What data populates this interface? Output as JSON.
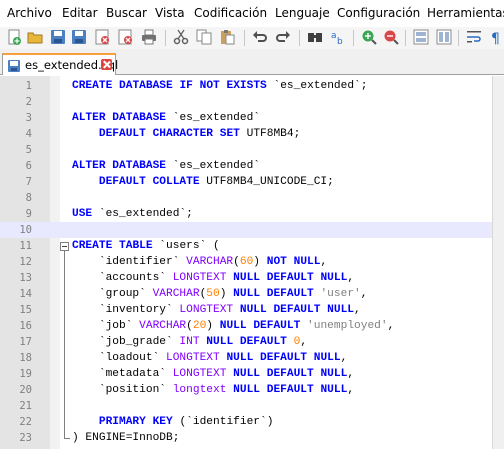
{
  "menu": [
    "Archivo",
    "Editar",
    "Buscar",
    "Vista",
    "Codificación",
    "Lenguaje",
    "Configuración",
    "Herramientas"
  ],
  "toolbar_icons": [
    "new-file-icon",
    "open-file-icon",
    "save-icon",
    "save-all-icon",
    "close-icon",
    "close-all-icon",
    "print-icon",
    "cut-icon",
    "copy-icon",
    "paste-icon",
    "undo-icon",
    "redo-icon",
    "find-icon",
    "replace-icon",
    "zoom-in-icon",
    "zoom-out-icon",
    "sync-v-icon",
    "sync-h-icon",
    "word-wrap-icon",
    "show-all-chars-icon"
  ],
  "tab": {
    "label": "es_extended.sql",
    "modified": true
  },
  "editor": {
    "current_line": 10,
    "lines": [
      {
        "n": "1",
        "code": "CREATE DATABASE IF NOT EXISTS `es_extended`;"
      },
      {
        "n": "2",
        "code": ""
      },
      {
        "n": "3",
        "code": "ALTER DATABASE `es_extended`"
      },
      {
        "n": "4",
        "code": "    DEFAULT CHARACTER SET UTF8MB4;"
      },
      {
        "n": "5",
        "code": ""
      },
      {
        "n": "6",
        "code": "ALTER DATABASE `es_extended`"
      },
      {
        "n": "7",
        "code": "    DEFAULT COLLATE UTF8MB4_UNICODE_CI;"
      },
      {
        "n": "8",
        "code": ""
      },
      {
        "n": "9",
        "code": "USE `es_extended`;"
      },
      {
        "n": "10",
        "code": ""
      },
      {
        "n": "11",
        "code": "CREATE TABLE `users` ("
      },
      {
        "n": "12",
        "code": "    `identifier` VARCHAR(60) NOT NULL,"
      },
      {
        "n": "13",
        "code": "    `accounts` LONGTEXT NULL DEFAULT NULL,"
      },
      {
        "n": "14",
        "code": "    `group` VARCHAR(50) NULL DEFAULT 'user',"
      },
      {
        "n": "15",
        "code": "    `inventory` LONGTEXT NULL DEFAULT NULL,"
      },
      {
        "n": "16",
        "code": "    `job` VARCHAR(20) NULL DEFAULT 'unemployed',"
      },
      {
        "n": "17",
        "code": "    `job_grade` INT NULL DEFAULT 0,"
      },
      {
        "n": "18",
        "code": "    `loadout` LONGTEXT NULL DEFAULT NULL,"
      },
      {
        "n": "19",
        "code": "    `metadata` LONGTEXT NULL DEFAULT NULL,"
      },
      {
        "n": "20",
        "code": "    `position` longtext NULL DEFAULT NULL,"
      },
      {
        "n": "21",
        "code": ""
      },
      {
        "n": "22",
        "code": "    PRIMARY KEY (`identifier`)"
      },
      {
        "n": "23",
        "code": ") ENGINE=InnoDB;"
      }
    ]
  },
  "colors": {
    "keyword": "#0000ff",
    "type": "#8000ff",
    "number": "#ff8000",
    "string": "#808080",
    "current_line": "#e8e8ff"
  }
}
